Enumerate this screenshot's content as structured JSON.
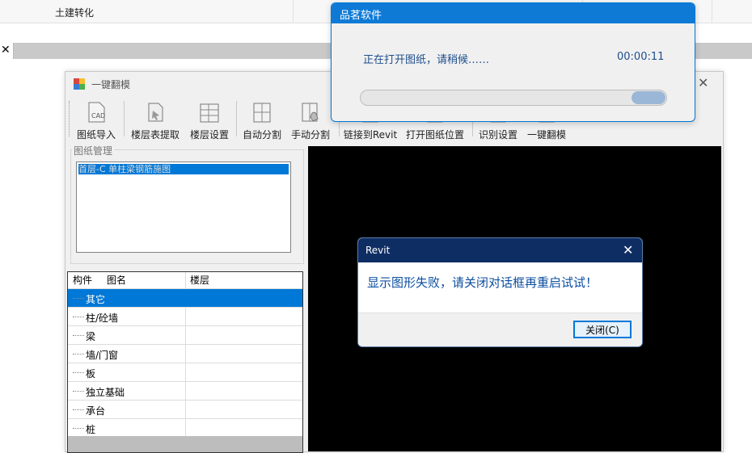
{
  "background_app": {
    "header_label": "土建转化",
    "tab_close_glyph": "✕"
  },
  "main_window": {
    "title": "一键翻模",
    "close_glyph": "✕",
    "toolbar": [
      {
        "label": "图纸导入",
        "icon": "cad-import-icon"
      },
      {
        "label": "楼层表提取",
        "icon": "floor-table-extract-icon"
      },
      {
        "label": "楼层设置",
        "icon": "floor-settings-icon"
      },
      {
        "label": "自动分割",
        "icon": "auto-split-icon"
      },
      {
        "label": "手动分割",
        "icon": "manual-split-icon"
      },
      {
        "label": "链接到Revit",
        "icon": "link-revit-icon"
      },
      {
        "label": "打开图纸位置",
        "icon": "open-drawing-location-icon"
      },
      {
        "label": "识别设置",
        "icon": "recognition-settings-icon"
      },
      {
        "label": "一键翻模",
        "icon": "one-click-model-icon"
      }
    ],
    "drawing_group_label": "图纸管理",
    "drawing_list": [
      "首层-C 单柱梁钢筋施图"
    ],
    "tree_headers": {
      "component": "构件",
      "drawing_name": "图名",
      "floor": "楼层"
    },
    "tree_rows": [
      {
        "label": "其它",
        "selected": true
      },
      {
        "label": "柱/砼墙",
        "selected": false
      },
      {
        "label": "梁",
        "selected": false
      },
      {
        "label": "墙/门窗",
        "selected": false
      },
      {
        "label": "板",
        "selected": false
      },
      {
        "label": "独立基础",
        "selected": false
      },
      {
        "label": "承台",
        "selected": false
      },
      {
        "label": "桩",
        "selected": false
      }
    ]
  },
  "progress_dialog": {
    "title": "品茗软件",
    "message": "正在打开图纸，请稍候……",
    "elapsed": "00:00:11",
    "progress_state": "indeterminate"
  },
  "error_dialog": {
    "title": "Revit",
    "close_glyph": "✕",
    "message": "显示图形失败，请关闭对话框再重启试试！",
    "button_label": "关闭(C)"
  },
  "colors": {
    "accent": "#0078d7",
    "progress_title": "#0f7ad6",
    "revit_title": "#0e2d63",
    "message_text": "#0c4ea0",
    "canvas": "#000000"
  }
}
